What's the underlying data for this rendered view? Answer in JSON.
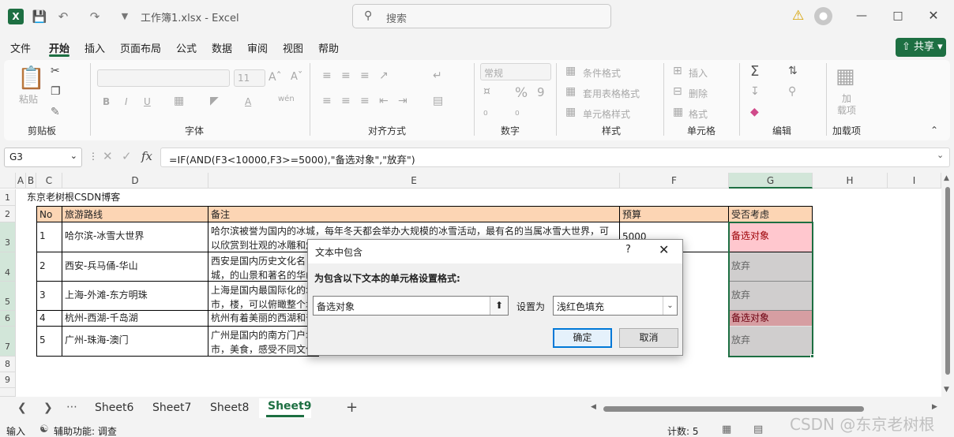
{
  "titlebar": {
    "doc_title": "工作簿1.xlsx  -  Excel",
    "search_placeholder": "搜索",
    "app_letter": "X"
  },
  "menu": {
    "items": [
      "文件",
      "开始",
      "插入",
      "页面布局",
      "公式",
      "数据",
      "审阅",
      "视图",
      "帮助"
    ],
    "share": "共享"
  },
  "ribbon": {
    "paste": "粘贴",
    "font_size": "11",
    "number_format": "常规",
    "cond_format": "条件格式",
    "table_format": "套用表格格式",
    "cell_style": "单元格样式",
    "insert": "插入",
    "delete": "删除",
    "format": "格式",
    "addin_line1": "加",
    "addin_line2": "载项",
    "groups": [
      "剪贴板",
      "字体",
      "对齐方式",
      "数字",
      "样式",
      "单元格",
      "编辑",
      "加载项"
    ]
  },
  "formula_bar": {
    "name_box": "G3",
    "formula": "=IF(AND(F3<10000,F3>=5000),\"备选对象\",\"放弃\")"
  },
  "columns": [
    "A",
    "B",
    "C",
    "D",
    "E",
    "F",
    "G",
    "H",
    "I"
  ],
  "rows": [
    "1",
    "2",
    "3",
    "4",
    "5",
    "6",
    "7",
    "8",
    "9"
  ],
  "sheet": {
    "title_cell": "东京老树根CSDN博客",
    "headers": [
      "No",
      "旅游路线",
      "备注",
      "预算",
      "受否考虑"
    ],
    "data": [
      {
        "no": "1",
        "route": "哈尔滨-冰雪大世界",
        "note": "哈尔滨被誉为国内的冰城，每年冬天都会举办大规模的冰雪活动，最有名的当属冰雪大世界，可以欣赏到壮观的冰雕和灯光",
        "budget": "5000",
        "consider": "备选对象"
      },
      {
        "no": "2",
        "route": "西安-兵马俑-华山",
        "note": "西安是国内历史文化名城，的山景和著名的华山夜游",
        "budget": "",
        "consider": "放弃"
      },
      {
        "no": "3",
        "route": "上海-外滩-东方明珠",
        "note": "上海是国内最国际化的城市，楼，可以俯瞰整个城市的",
        "budget": "",
        "consider": "放弃"
      },
      {
        "no": "4",
        "route": "杭州-西湖-千岛湖",
        "note": "杭州有着美丽的西湖和千岛湖",
        "budget": "",
        "consider": "备选对象"
      },
      {
        "no": "5",
        "route": "广州-珠海-澳门",
        "note": "广州是国内的南方门户城市，美食，感受不同文化的魅力",
        "budget": "",
        "consider": "放弃"
      }
    ]
  },
  "dialog": {
    "title": "文本中包含",
    "help": "?",
    "prompt": "为包含以下文本的单元格设置格式:",
    "text_value": "备选对象",
    "set_label": "设置为",
    "format_value": "浅红色填充",
    "ok": "确定",
    "cancel": "取消"
  },
  "tabs": [
    "Sheet6",
    "Sheet7",
    "Sheet8",
    "Sheet9"
  ],
  "status": {
    "mode": "输入",
    "accessibility": "辅助功能: 调查",
    "count": "计数: 5"
  },
  "watermark": "CSDN @东京老树根",
  "colors": {
    "excel_green": "#1d6f42",
    "header_fill": "#fcd5b4",
    "light_red_fill": "#ffc7ce",
    "gray_fill": "#d0cece"
  }
}
